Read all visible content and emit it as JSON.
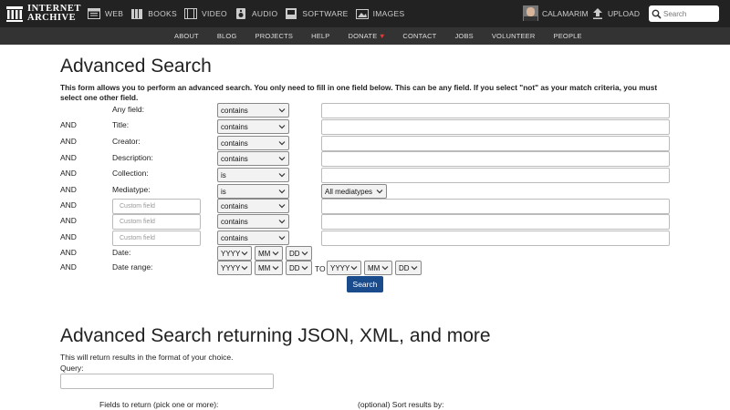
{
  "header": {
    "logo_line1": "INTERNET",
    "logo_line2": "ARCHIVE",
    "nav": [
      {
        "label": "WEB",
        "icon": "web-icon"
      },
      {
        "label": "BOOKS",
        "icon": "books-icon"
      },
      {
        "label": "VIDEO",
        "icon": "video-icon"
      },
      {
        "label": "AUDIO",
        "icon": "audio-icon"
      },
      {
        "label": "SOFTWARE",
        "icon": "software-icon"
      },
      {
        "label": "IMAGES",
        "icon": "images-icon"
      }
    ],
    "username": "CALAMARIM",
    "upload_label": "UPLOAD",
    "search_placeholder": "Search"
  },
  "subnav": [
    "ABOUT",
    "BLOG",
    "PROJECTS",
    "HELP",
    "DONATE",
    "CONTACT",
    "JOBS",
    "VOLUNTEER",
    "PEOPLE"
  ],
  "form": {
    "title": "Advanced Search",
    "intro": "This form allows you to perform an advanced search. You only need to fill in one field below. This can be any field. If you select \"not\" as your match criteria, you must select one other field.",
    "and_label": "AND",
    "rows": [
      {
        "label": "Any field:",
        "operator": "contains"
      },
      {
        "label": "Title:",
        "operator": "contains"
      },
      {
        "label": "Creator:",
        "operator": "contains"
      },
      {
        "label": "Description:",
        "operator": "contains"
      },
      {
        "label": "Collection:",
        "operator": "is"
      },
      {
        "label": "Mediatype:",
        "operator": "is",
        "value_select": "All mediatypes"
      }
    ],
    "custom_placeholder": "Custom field",
    "custom_operator": "contains",
    "date_label": "Date:",
    "date_range_label": "Date range:",
    "yyyy": "YYYY",
    "mm": "MM",
    "dd": "DD",
    "to_label": "TO",
    "search_button": "Search"
  },
  "json_section": {
    "title": "Advanced Search returning JSON, XML, and more",
    "intro": "This will return results in the format of your choice.",
    "query_label": "Query:",
    "fields_label": "Fields to return (pick one or more):",
    "sort_label": "(optional) Sort results by:"
  },
  "colors": {
    "topbar": "#222222",
    "subbar": "#333333",
    "button": "#1a4b8c",
    "donate_heart": "#e33333"
  }
}
